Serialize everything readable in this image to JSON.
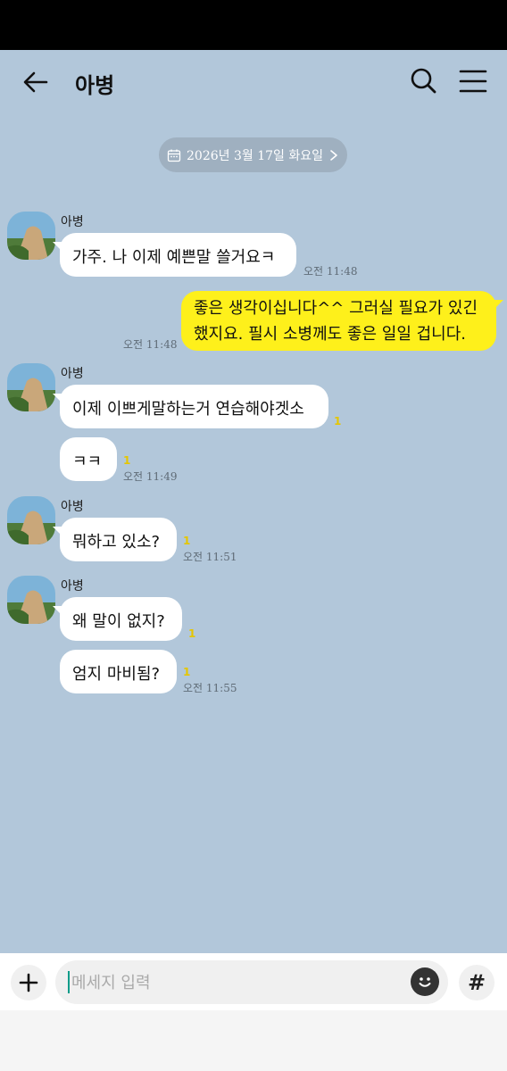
{
  "header": {
    "title": "아병",
    "back_icon": "arrow-left-icon",
    "search_icon": "search-icon",
    "menu_icon": "hamburger-menu-icon"
  },
  "date_divider": {
    "label": "2026년 3월 17일 화요일",
    "icon": "calendar-icon",
    "chevron": "chevron-right-icon"
  },
  "colors": {
    "background": "#b2c7da",
    "my_bubble": "#fef01b",
    "their_bubble": "#ffffff",
    "unread": "#e5c600"
  },
  "messages": [
    {
      "sender": "아병",
      "text": "가주. 나 이제 예쁜말 쓸거요ㅋ",
      "time": "오전 11:48"
    },
    {
      "sender": "me",
      "text": "좋은 생각이십니다^^ 그러실 필요가 있긴 했지요. 필시 소병께도 좋은 일일 겁니다.",
      "time": "오전 11:48"
    },
    {
      "sender": "아병",
      "text": "이제 이쁘게말하는거 연습해야겟소",
      "unread": "1"
    },
    {
      "sender": "아병",
      "text": "ㅋㅋ",
      "unread": "1",
      "time": "오전 11:49"
    },
    {
      "sender": "아병",
      "text": "뭐하고 있소?",
      "unread": "1",
      "time": "오전 11:51"
    },
    {
      "sender": "아병",
      "text": "왜 말이 없지?",
      "unread": "1"
    },
    {
      "sender": "아병",
      "text": "엄지 마비됨?",
      "unread": "1",
      "time": "오전 11:55"
    }
  ],
  "composer": {
    "placeholder": "메세지 입력",
    "plus_icon": "plus-icon",
    "emoji_icon": "emoji-icon",
    "hash_label": "#"
  }
}
